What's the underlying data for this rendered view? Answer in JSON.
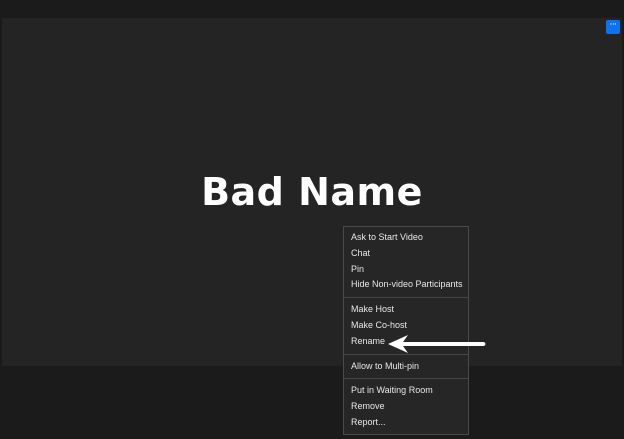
{
  "tile": {
    "participant_name": "Bad Name",
    "more_button_glyph": "···"
  },
  "context_menu": {
    "groups": [
      [
        "Ask to Start Video",
        "Chat",
        "Pin",
        "Hide Non-video Participants"
      ],
      [
        "Make Host",
        "Make Co-host",
        "Rename"
      ],
      [
        "Allow to Multi-pin"
      ],
      [
        "Put in Waiting Room",
        "Remove",
        "Report..."
      ]
    ]
  },
  "colors": {
    "accent": "#0e72ed",
    "tile_background": "#242424",
    "menu_background": "#262626",
    "annotation_arrow": "#ffffff"
  },
  "icons": {
    "more": "more-options-icon",
    "annotation": "arrow-left-icon"
  }
}
